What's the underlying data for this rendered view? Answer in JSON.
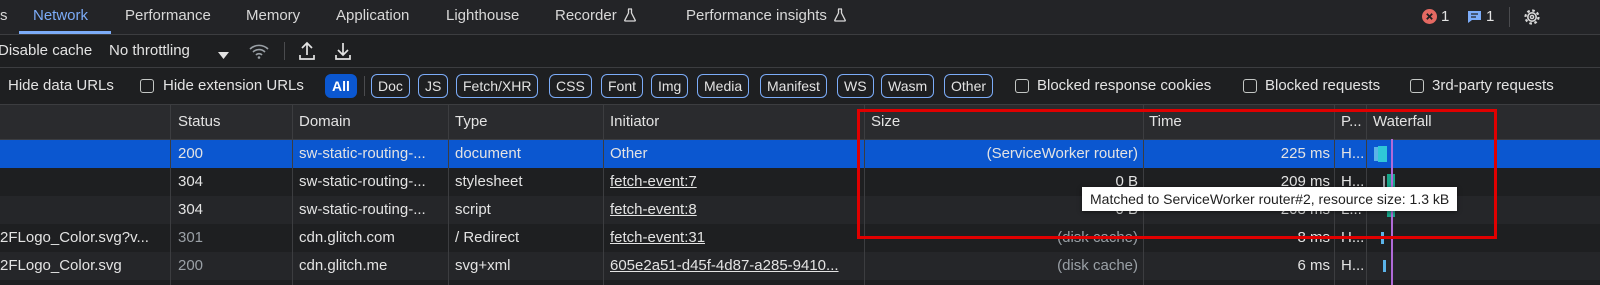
{
  "tabs": [
    {
      "label": "s"
    },
    {
      "label": "Network"
    },
    {
      "label": "Performance"
    },
    {
      "label": "Memory"
    },
    {
      "label": "Application"
    },
    {
      "label": "Lighthouse"
    },
    {
      "label": "Recorder"
    },
    {
      "label": "Performance insights"
    }
  ],
  "status": {
    "errors": "1",
    "messages": "1"
  },
  "toolbar": {
    "disable_cache": "Disable cache",
    "throttling": "No throttling"
  },
  "filters": {
    "hide_data_urls": "Hide data URLs",
    "hide_extension_urls": "Hide extension URLs",
    "types": [
      "All",
      "Doc",
      "JS",
      "Fetch/XHR",
      "CSS",
      "Font",
      "Img",
      "Media",
      "Manifest",
      "WS",
      "Wasm",
      "Other"
    ],
    "blocked_cookies": "Blocked response cookies",
    "blocked_requests": "Blocked requests",
    "third_party": "3rd-party requests"
  },
  "table": {
    "columns": [
      "Status",
      "Domain",
      "Type",
      "Initiator",
      "Size",
      "Time",
      "P...",
      "Waterfall"
    ],
    "rows": [
      {
        "name": "",
        "status": "200",
        "domain": "sw-static-routing-...",
        "type": "document",
        "initiator": "Other",
        "size": "(ServiceWorker router)",
        "time": "225 ms",
        "protocol": "H..."
      },
      {
        "name": "",
        "status": "304",
        "domain": "sw-static-routing-...",
        "type": "stylesheet",
        "initiator": "fetch-event:7",
        "size": "0 B",
        "time": "209 ms",
        "protocol": "H..."
      },
      {
        "name": "",
        "status": "304",
        "domain": "sw-static-routing-...",
        "type": "script",
        "initiator": "fetch-event:8",
        "size": "0 B",
        "time": "208 ms",
        "protocol": "L..."
      },
      {
        "name": "2FLogo_Color.svg?v...",
        "status": "301",
        "domain": "cdn.glitch.com",
        "type": "/ Redirect",
        "initiator": "fetch-event:31",
        "size": "(disk cache)",
        "time": "8 ms",
        "protocol": "H..."
      },
      {
        "name": "2FLogo_Color.svg",
        "status": "200",
        "domain": "cdn.glitch.me",
        "type": "svg+xml",
        "initiator": "605e2a51-d45f-4d87-a285-9410...",
        "size": "(disk cache)",
        "time": "6 ms",
        "protocol": "H..."
      }
    ]
  },
  "tooltip": "Matched to ServiceWorker router#2, resource size: 1.3 kB",
  "colors": {
    "accent": "#7cacf8",
    "selected_row": "#0b57d0",
    "highlight_box": "#e00000",
    "error": "#e46962"
  }
}
